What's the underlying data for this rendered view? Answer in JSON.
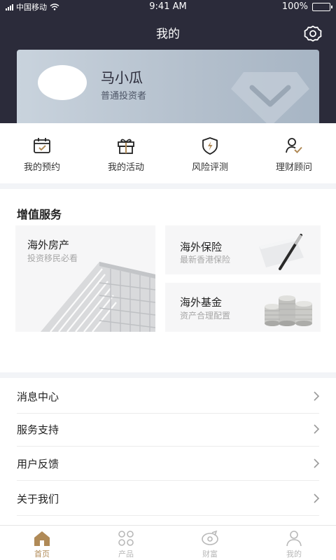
{
  "status_bar": {
    "carrier": "中国移动",
    "time": "9:41 AM",
    "battery": "100%"
  },
  "header": {
    "title": "我的"
  },
  "profile": {
    "name": "马小瓜",
    "level": "普通投资者"
  },
  "quick_actions": [
    {
      "label": "我的预约",
      "icon": "calendar-check-icon"
    },
    {
      "label": "我的活动",
      "icon": "gift-icon"
    },
    {
      "label": "风险评测",
      "icon": "shield-bolt-icon"
    },
    {
      "label": "理财顾问",
      "icon": "advisor-icon"
    }
  ],
  "services": {
    "title": "增值服务",
    "items": [
      {
        "title": "海外房产",
        "subtitle": "投资移民必看",
        "icon": "building-image"
      },
      {
        "title": "海外保险",
        "subtitle": "最新香港保险",
        "icon": "pen-paper-image"
      },
      {
        "title": "海外基金",
        "subtitle": "资产合理配置",
        "icon": "coins-image"
      }
    ]
  },
  "menu": [
    {
      "label": "消息中心"
    },
    {
      "label": "服务支持"
    },
    {
      "label": "用户反馈"
    },
    {
      "label": "关于我们"
    }
  ],
  "tabs": [
    {
      "label": "首页",
      "icon": "home-icon",
      "active": true
    },
    {
      "label": "产品",
      "icon": "grid-icon",
      "active": false
    },
    {
      "label": "财富",
      "icon": "wealth-icon",
      "active": false
    },
    {
      "label": "我的",
      "icon": "user-icon",
      "active": false
    }
  ],
  "colors": {
    "header_bg": "#2b2b3a",
    "accent": "#b08a57",
    "inactive": "#b8b8b8"
  }
}
